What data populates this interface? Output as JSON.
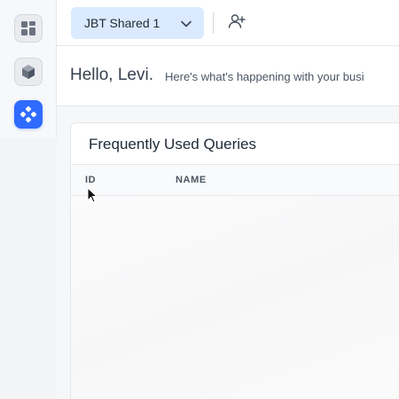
{
  "rail": {
    "items": [
      {
        "icon": "dashboard-grid-icon",
        "active": false
      },
      {
        "icon": "cube-icon",
        "active": false
      },
      {
        "icon": "diamond-app-icon",
        "active": true
      }
    ]
  },
  "topbar": {
    "workspace_label": "JBT Shared 1",
    "workspace_chevron": "chevron-down-icon",
    "invite_icon": "add-user-icon"
  },
  "greeting": {
    "hello": "Hello, Levi.",
    "subtitle": "Here's what's happening with your busi"
  },
  "queries_card": {
    "title": "Frequently Used Queries",
    "columns": [
      "ID",
      "NAME"
    ],
    "rows": []
  },
  "colors": {
    "accent": "#2f6bff",
    "workspace_button_bg": "#dbeafe"
  }
}
